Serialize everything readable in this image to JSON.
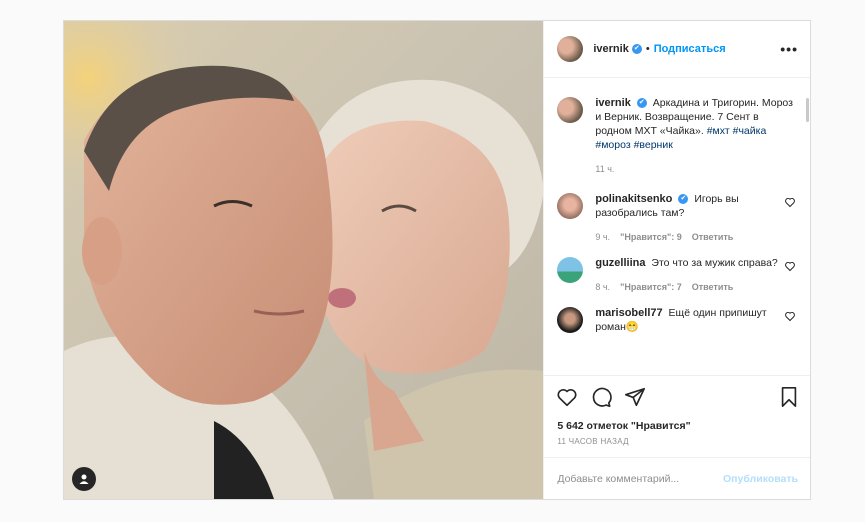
{
  "post": {
    "username": "ivernik",
    "separator": "•",
    "follow_label": "Подписаться",
    "more_label": "•••"
  },
  "caption": {
    "username": "ivernik",
    "text": "Аркадина и Тригорин. Мороз и Верник. Возвращение. 7 Сент в родном МХТ «Чайка».",
    "hashtags": [
      "#мхт",
      "#чайка",
      "#мороз",
      "#верник"
    ],
    "time": "11 ч."
  },
  "comments": [
    {
      "username": "polinakitsenko",
      "verified": true,
      "text": "Игорь вы разобрались там?",
      "time": "9 ч.",
      "likes": "\"Нравится\": 9",
      "reply": "Ответить"
    },
    {
      "username": "guzelliina",
      "verified": false,
      "text": "Это что за мужик справа?",
      "time": "8 ч.",
      "likes": "\"Нравится\": 7",
      "reply": "Ответить"
    },
    {
      "username": "marisobell77",
      "verified": false,
      "text": "Ещё один припишут роман😁",
      "time": "",
      "likes": "",
      "reply": ""
    }
  ],
  "stats": {
    "likes": "5 642 отметок \"Нравится\"",
    "posted": "11 ЧАСОВ НАЗАД"
  },
  "composer": {
    "placeholder": "Добавьте комментарий...",
    "publish_label": "Опубликовать"
  },
  "colors": {
    "accent": "#0095f6",
    "verified": "#3897f0",
    "publish_disabled": "#b2dffc"
  }
}
